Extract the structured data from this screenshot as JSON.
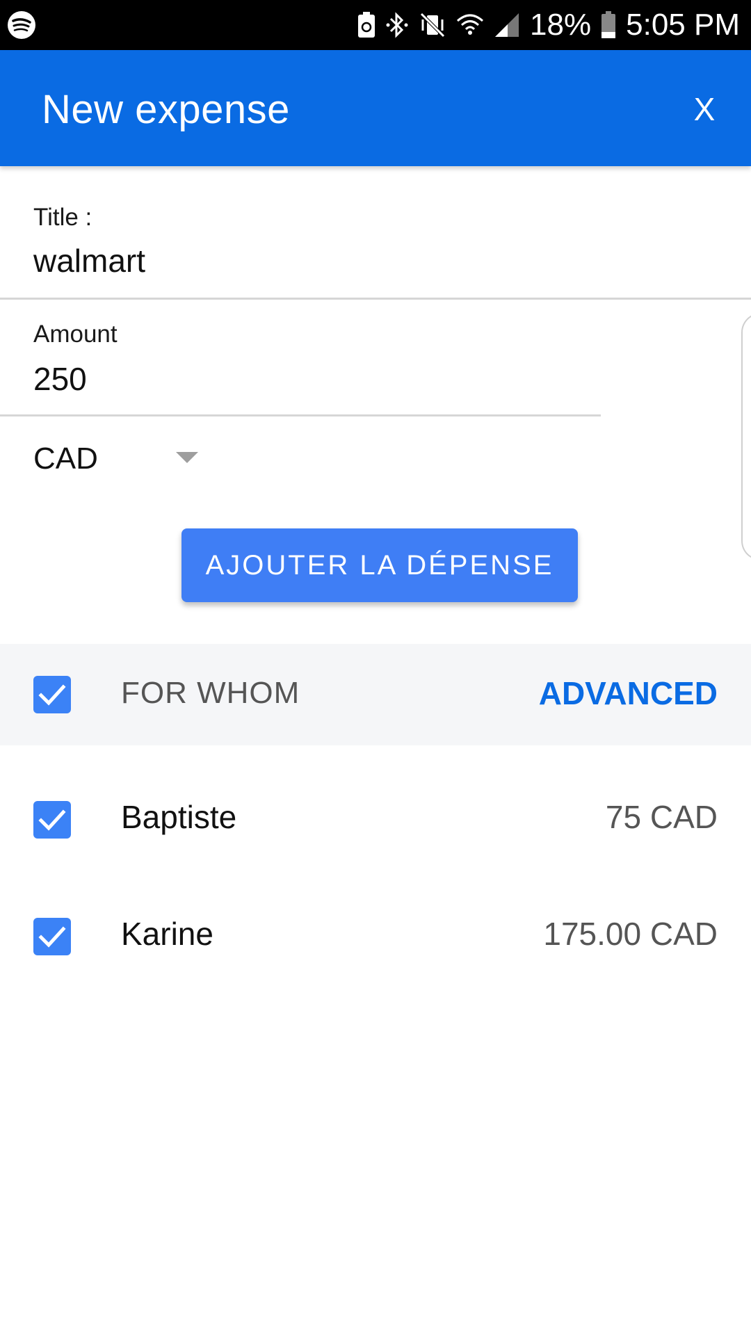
{
  "status_bar": {
    "battery_percent": "18%",
    "time": "5:05 PM",
    "icons": [
      "spotify-icon",
      "battery-saver-icon",
      "bluetooth-icon",
      "vibrate-mute-icon",
      "wifi-icon",
      "cell-signal-icon",
      "battery-icon"
    ]
  },
  "app_bar": {
    "title": "New expense",
    "close_label": "X"
  },
  "form": {
    "title_label": "Title :",
    "title_value": "walmart",
    "amount_label": "Amount",
    "amount_value": "250",
    "currency_value": "CAD",
    "submit_label": "AJOUTER LA DÉPENSE"
  },
  "for_whom": {
    "label": "FOR WHOM",
    "checked": true,
    "advanced_label": "ADVANCED"
  },
  "participants": [
    {
      "name": "Baptiste",
      "amount": "75 CAD",
      "checked": true
    },
    {
      "name": "Karine",
      "amount": "175.00 CAD",
      "checked": true
    }
  ],
  "colors": {
    "app_bar": "#0a6be3",
    "button": "#3f7ef5",
    "checkbox": "#3b82f6",
    "accent_link": "#0a6be3"
  }
}
